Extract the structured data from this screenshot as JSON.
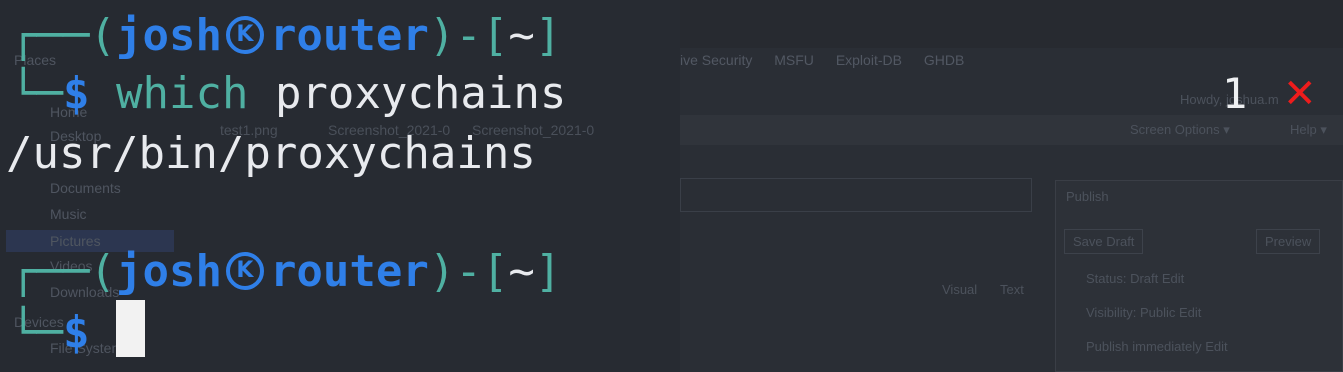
{
  "background": {
    "sidebar_items": [
      "Places",
      "Home",
      "Desktop",
      "Documents",
      "Music",
      "Pictures",
      "Videos",
      "Downloads",
      "Devices",
      "File System"
    ],
    "files": [
      "test1.png",
      "Screenshot_2021-0",
      "Screenshot_2021-0"
    ],
    "bookmarks": [
      "ive Security",
      "MSFU",
      "Exploit-DB",
      "GHDB"
    ],
    "howdy": "Howdy, joshua.m",
    "screen_options": "Screen Options ▾",
    "help": "Help ▾",
    "publish_title": "Publish",
    "save_draft": "Save Draft",
    "preview": "Preview",
    "status": "Status: Draft Edit",
    "visibility": "Visibility: Public Edit",
    "publish_when": "Publish immediately Edit",
    "visual": "Visual",
    "text": "Text"
  },
  "terminal": {
    "prompt1": {
      "corner_top": "┌──(",
      "user": "josh",
      "host": "router",
      "close": ")-[",
      "dir": "~",
      "end": "]",
      "corner_bottom": "└─",
      "dollar": "$",
      "command": "which",
      "argument": "proxychains"
    },
    "output": "/usr/bin/proxychains",
    "prompt2": {
      "corner_top": "┌──(",
      "user": "josh",
      "host": "router",
      "close": ")-[",
      "dir": "~",
      "end": "]",
      "corner_bottom": "└─",
      "dollar": "$"
    },
    "exit_code": "1",
    "exit_icon": "✕"
  },
  "colors": {
    "prompt_frame": "#4fb0a2",
    "user_host": "#2f7fe8",
    "text": "#e8eaee",
    "error": "#ee1c1c",
    "background": "#23272e"
  }
}
